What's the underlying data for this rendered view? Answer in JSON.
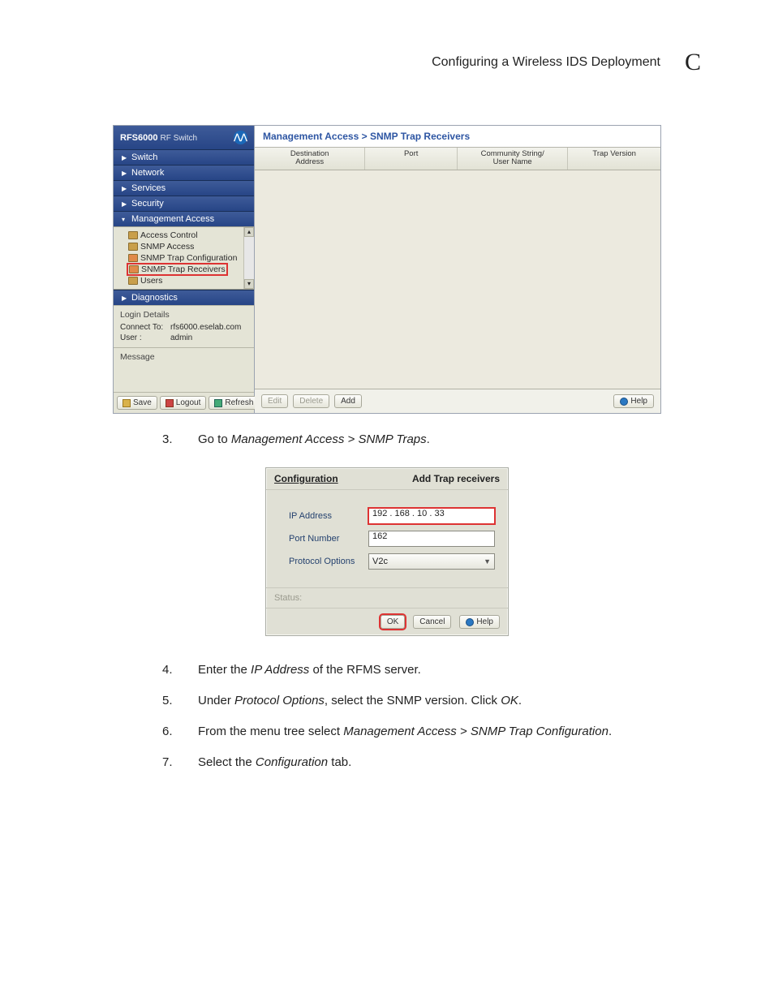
{
  "page_header": {
    "title": "Configuring a Wireless IDS Deployment",
    "letter": "C"
  },
  "product": {
    "model": "RFS6000",
    "sub": "RF Switch",
    "logo_glyph": "⋀⋀"
  },
  "nav": {
    "switch": "Switch",
    "network": "Network",
    "services": "Services",
    "security": "Security",
    "management": "Management Access",
    "diagnostics": "Diagnostics"
  },
  "tree_items": {
    "access_control": "Access Control",
    "snmp_access": "SNMP Access",
    "snmp_trap_config": "SNMP Trap Configuration",
    "snmp_trap_receivers": "SNMP Trap Receivers",
    "users": "Users"
  },
  "login": {
    "heading": "Login Details",
    "connect_label": "Connect To:",
    "connect_value": "rfs6000.eselab.com",
    "user_label": "User :",
    "user_value": "admin"
  },
  "message_heading": "Message",
  "left_buttons": {
    "save": "Save",
    "logout": "Logout",
    "refresh": "Refresh"
  },
  "breadcrumb": "Management Access > SNMP Trap Receivers",
  "columns": {
    "dest": "Destination\nAddress",
    "port": "Port",
    "community": "Community String/\nUser Name",
    "trap": "Trap Version"
  },
  "right_buttons": {
    "edit": "Edit",
    "delete": "Delete",
    "add": "Add",
    "help": "Help"
  },
  "step3": {
    "num": "3.",
    "pre": "Go to ",
    "ital": "Management Access > SNMP Traps",
    "post": "."
  },
  "dialog": {
    "tab_left": "Configuration",
    "tab_right": "Add Trap receivers",
    "ip_label": "IP Address",
    "ip_value": "192 . 168 .  10  .  33",
    "port_label": "Port Number",
    "port_value": "162",
    "proto_label": "Protocol Options",
    "proto_value": "V2c",
    "status_label": "Status:",
    "ok": "OK",
    "cancel": "Cancel",
    "help": "Help"
  },
  "step4": {
    "num": "4.",
    "p0": "Enter the ",
    "i0": "IP Address",
    "p1": " of the RFMS server."
  },
  "step5": {
    "num": "5.",
    "p0": "Under ",
    "i0": "Protocol Options",
    "p1": ", select the SNMP version. Click ",
    "i1": "OK",
    "p2": "."
  },
  "step6": {
    "num": "6.",
    "p0": "From the menu tree select ",
    "i0": "Management Access > SNMP Trap Configuration",
    "p1": "."
  },
  "step7": {
    "num": "7.",
    "p0": " Select the ",
    "i0": "Configuration",
    "p1": " tab."
  }
}
